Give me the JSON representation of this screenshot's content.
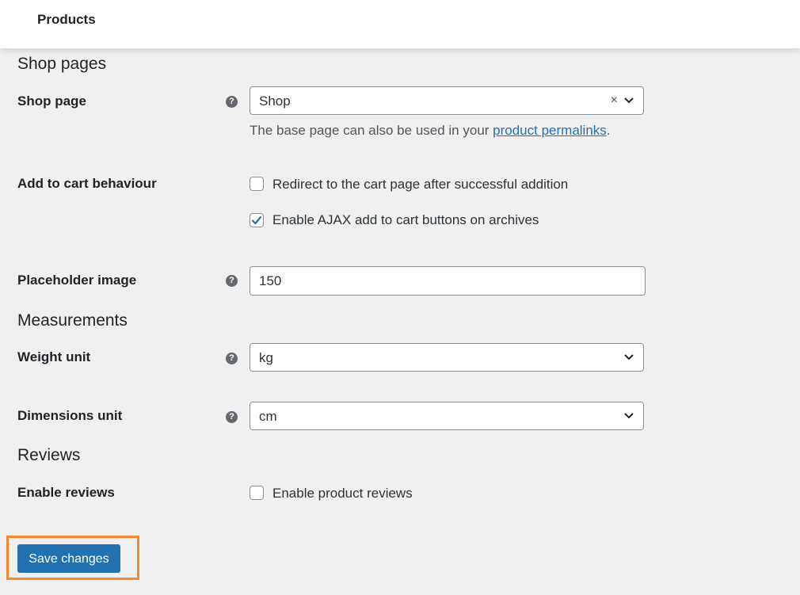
{
  "topbar": {
    "title": "Products"
  },
  "sections": {
    "shop_pages": "Shop pages",
    "measurements": "Measurements",
    "reviews": "Reviews"
  },
  "shop_page": {
    "label": "Shop page",
    "value": "Shop",
    "clear": "×",
    "desc_before": "The base page can also be used in your ",
    "desc_link": "product permalinks",
    "desc_after": "."
  },
  "add_to_cart": {
    "label": "Add to cart behaviour",
    "options": [
      {
        "label": "Redirect to the cart page after successful addition",
        "checked": false
      },
      {
        "label": "Enable AJAX add to cart buttons on archives",
        "checked": true
      }
    ]
  },
  "placeholder_image": {
    "label": "Placeholder image",
    "value": "150"
  },
  "weight_unit": {
    "label": "Weight unit",
    "value": "kg"
  },
  "dimensions_unit": {
    "label": "Dimensions unit",
    "value": "cm"
  },
  "enable_reviews": {
    "label": "Enable reviews",
    "option": {
      "label": "Enable product reviews",
      "checked": false
    }
  },
  "save_button": {
    "label": "Save changes"
  },
  "help_icon": "?",
  "colors": {
    "accent": "#2271b1",
    "highlight": "#f58a2a",
    "background": "#f0f0f1"
  },
  "icons": {
    "help": "help-icon",
    "chevron": "chevron-down-icon",
    "check": "checkmark-icon"
  }
}
